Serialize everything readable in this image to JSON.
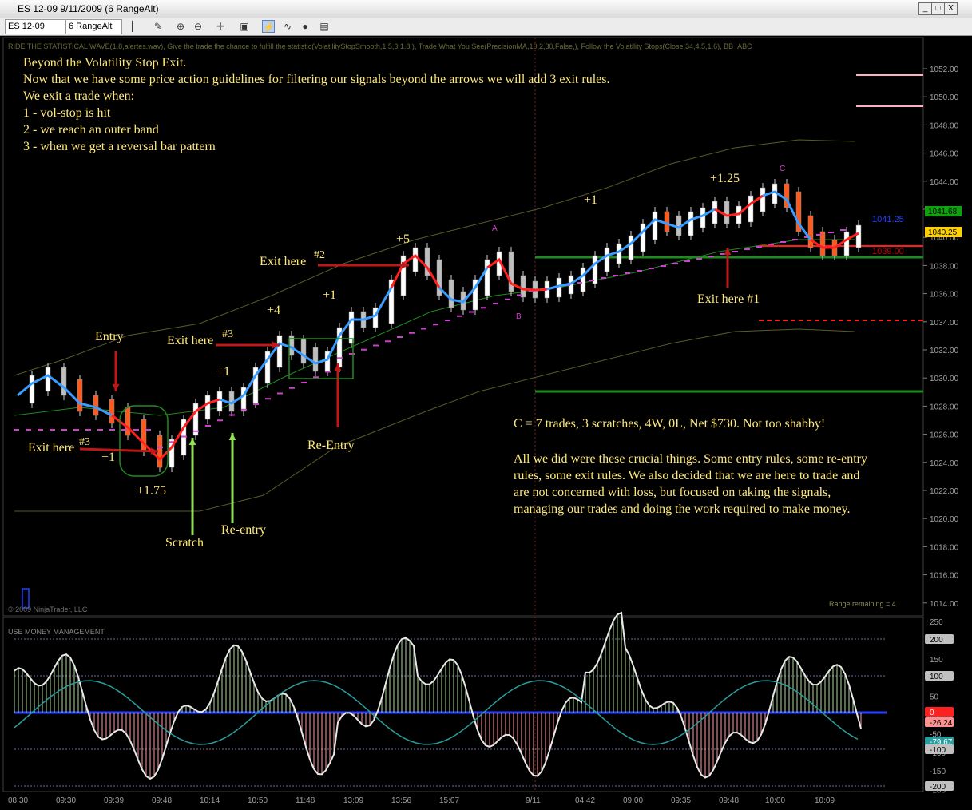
{
  "window": {
    "title": "ES 12-09  9/11/2009 (6 RangeAlt)",
    "min": "_",
    "max": "□",
    "close": "X"
  },
  "toolbar": {
    "instrument": "ES 12-09",
    "period": "6 RangeAlt"
  },
  "indicator_header": "RIDE THE STATISTICAL WAVE(1.8,alertes.wav), Give the trade the chance to fulfill the statistic(VolatilityStopSmooth,1.5,3,1.8,), Trade What You See(PrecisionMA,10,2,30,False,), Follow the Volatility Stops(Close,34,4.5,1.6), BB_ABC",
  "intro": [
    "Beyond the Volatility Stop Exit.",
    "Now that we have some price action guidelines for filtering our signals beyond the arrows we will add 3 exit rules.",
    "We exit a trade when:",
    "1 -  vol-stop is hit",
    "2 - we reach an outer band",
    "3 - when we get a reversal bar pattern"
  ],
  "labels": {
    "entry": "Entry",
    "exit3a": "Exit here",
    "exit3a_num": "#3",
    "plus1a": "+1",
    "plus175": "+1.75",
    "scratch": "Scratch",
    "reentry_low": "Re-entry",
    "exit3b": "Exit here",
    "exit3b_num": "#3",
    "plus1b": "+1",
    "plus4": "+4",
    "plus1c": "+1",
    "reentry_up": "Re-Entry",
    "exit2": "Exit here",
    "exit2_num": "#2",
    "plus5": "+5",
    "plus1d": "+1",
    "plus125": "+1.25",
    "exit1": "Exit here #1",
    "mark_a": "A",
    "mark_b": "B",
    "mark_c": "C"
  },
  "summary": [
    "C = 7 trades, 3 scratches, 4W, 0L, Net $730. Not too shabby!",
    "",
    "All we did were these crucial things. Some entry rules, some re-entry",
    "rules, some exit rules.  We also decided that we are here to trade and",
    "are not concerned with loss, but focused on taking the signals,",
    "managing our trades and doing the work required to make money."
  ],
  "price_axis": [
    "1052.00",
    "1050.00",
    "1048.00",
    "1046.00",
    "1044.00",
    "1042.00",
    "1040.00",
    "1038.00",
    "1036.00",
    "1034.00",
    "1032.00",
    "1030.00",
    "1028.00",
    "1026.00",
    "1024.00",
    "1022.00",
    "1020.00",
    "1018.00",
    "1016.00",
    "1014.00"
  ],
  "price_tags": [
    {
      "text": "1041.25",
      "color": "#2040ff"
    },
    {
      "text": "1039.00",
      "color": "#c00000"
    }
  ],
  "price_badges": [
    {
      "text": "1041.68",
      "bg": "#10a010"
    },
    {
      "text": "1040.25",
      "bg": "#ffd000"
    }
  ],
  "copyright": "© 2009 NinjaTrader, LLC",
  "range_remaining": "Range remaining = 4",
  "mm_panel": {
    "title": "USE MONEY MANAGEMENT",
    "axis": [
      "250",
      "200",
      "150",
      "100",
      "50",
      "0",
      "-50",
      "-100",
      "-150",
      "-200"
    ],
    "badges": [
      {
        "text": "200",
        "bg": "#c0c0c0",
        "fg": "#000"
      },
      {
        "text": "100",
        "bg": "#c0c0c0",
        "fg": "#000"
      },
      {
        "text": "0",
        "bg": "#ff2020",
        "fg": "#fff"
      },
      {
        "text": "-26.24",
        "bg": "#ff9090",
        "fg": "#000"
      },
      {
        "text": "-79.67",
        "bg": "#2a9d9d",
        "fg": "#fff"
      },
      {
        "text": "-100",
        "bg": "#c0c0c0",
        "fg": "#000"
      },
      {
        "text": "-200",
        "bg": "#c0c0c0",
        "fg": "#000"
      }
    ]
  },
  "time_axis": [
    "08:30",
    "09:30",
    "09:39",
    "09:48",
    "10:14",
    "10:50",
    "11:48",
    "13:09",
    "13:56",
    "15:07",
    "9/11",
    "04:42",
    "09:00",
    "09:35",
    "09:48",
    "10:00",
    "10:09"
  ],
  "colors": {
    "bull": "#ffffff",
    "bear": "#ff5a1e",
    "up_line": "#3a9cff",
    "down_line": "#ff2020",
    "green": "#1f8a1f",
    "magenta": "#d040d0",
    "annotation": "#ffe97a",
    "band": "#5a5a2a"
  }
}
